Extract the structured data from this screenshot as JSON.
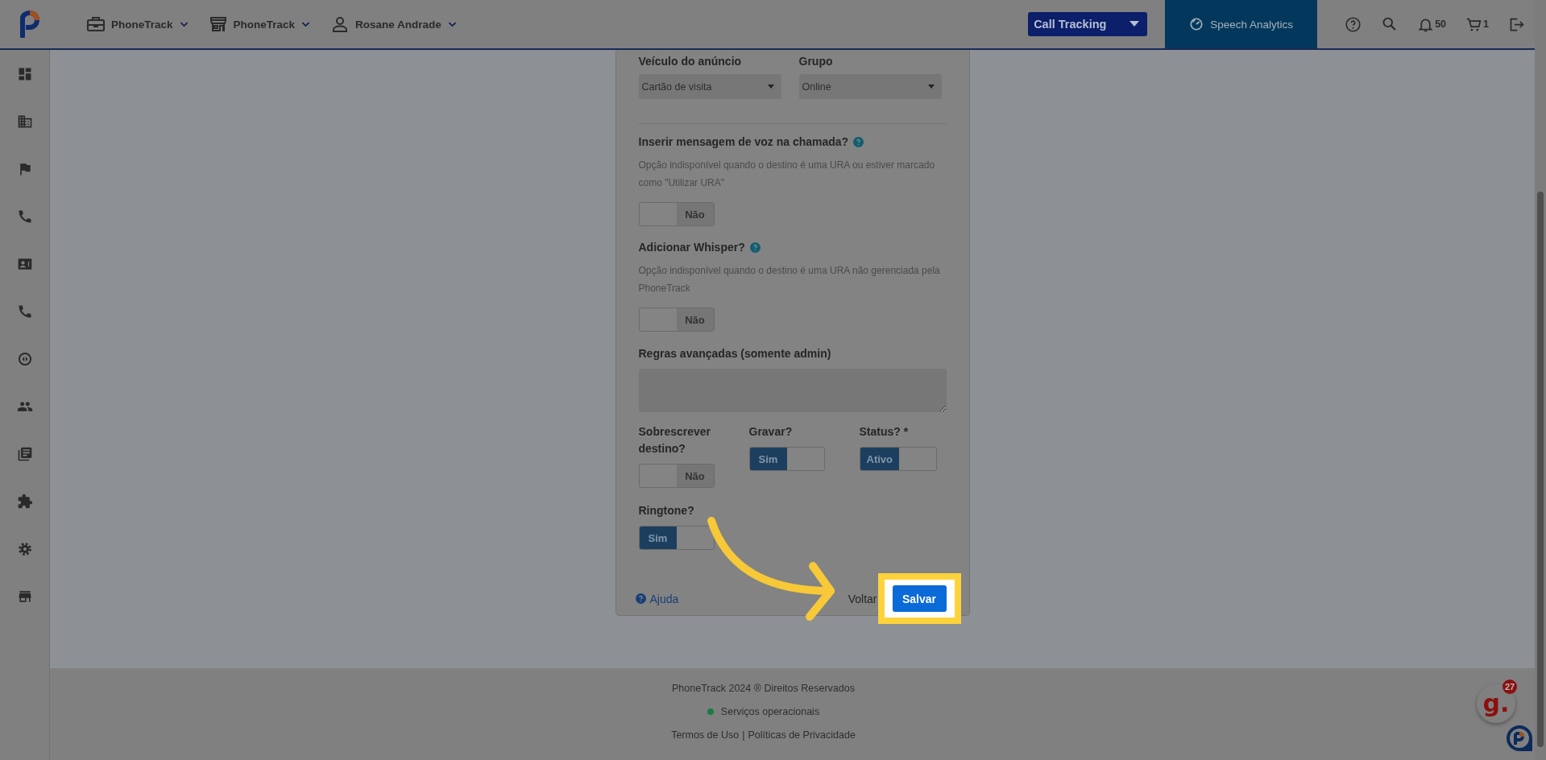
{
  "header": {
    "nav": [
      {
        "label": "PhoneTrack",
        "kind": "briefcase"
      },
      {
        "label": "PhoneTrack",
        "kind": "store"
      },
      {
        "label": "Rosane Andrade",
        "kind": "person"
      }
    ],
    "product_select": "Call Tracking",
    "speech_button": "Speech Analytics",
    "notifications": "50",
    "cart": "1"
  },
  "sidebar": {
    "items": [
      {
        "kind": "dashboard"
      },
      {
        "kind": "building"
      },
      {
        "kind": "flag"
      },
      {
        "kind": "phone"
      },
      {
        "kind": "contact"
      },
      {
        "kind": "phone"
      },
      {
        "kind": "disc"
      },
      {
        "kind": "people"
      },
      {
        "kind": "list"
      },
      {
        "kind": "puzzle"
      },
      {
        "kind": "gear"
      },
      {
        "kind": "store"
      }
    ]
  },
  "form": {
    "selects": [
      {
        "label": "Veículo do anúncio",
        "value": "Cartão de visita"
      },
      {
        "label": "Grupo",
        "value": "Online"
      }
    ],
    "options": [
      {
        "label": "Inserir mensagem de voz na chamada?",
        "note": "Opção indisponível quando o destino é uma URA ou estiver marcado como \"Utilizar URA\"",
        "on": false,
        "text": "Não"
      },
      {
        "label": "Adicionar Whisper?",
        "note": "Opção indisponível quando o destino é uma URA não gerenciada pela PhoneTrack",
        "on": false,
        "text": "Não"
      }
    ],
    "rules_label": "Regras avançadas (somente admin)",
    "switches": [
      {
        "label": "Sobrescrever destino?",
        "on": false,
        "text": "Não"
      },
      {
        "label": "Gravar?",
        "on": true,
        "text": "Sim"
      },
      {
        "label": "Status? *",
        "on": true,
        "text": "Ativo"
      },
      {
        "label": "Ringtone?",
        "on": true,
        "text": "Sim"
      }
    ],
    "help_link": "Ajuda",
    "back": "Voltar",
    "save": "Salvar"
  },
  "footer": {
    "copyright": "PhoneTrack 2024 ® Direitos Reservados",
    "status": {
      "text": "Serviços operacionais",
      "color": "#1b7a48"
    },
    "links": [
      "Termos de Uso",
      "Políticas de Privacidade"
    ],
    "separator": "|"
  },
  "widgets": {
    "chat_letter": "g.",
    "chat_badge": "27"
  }
}
